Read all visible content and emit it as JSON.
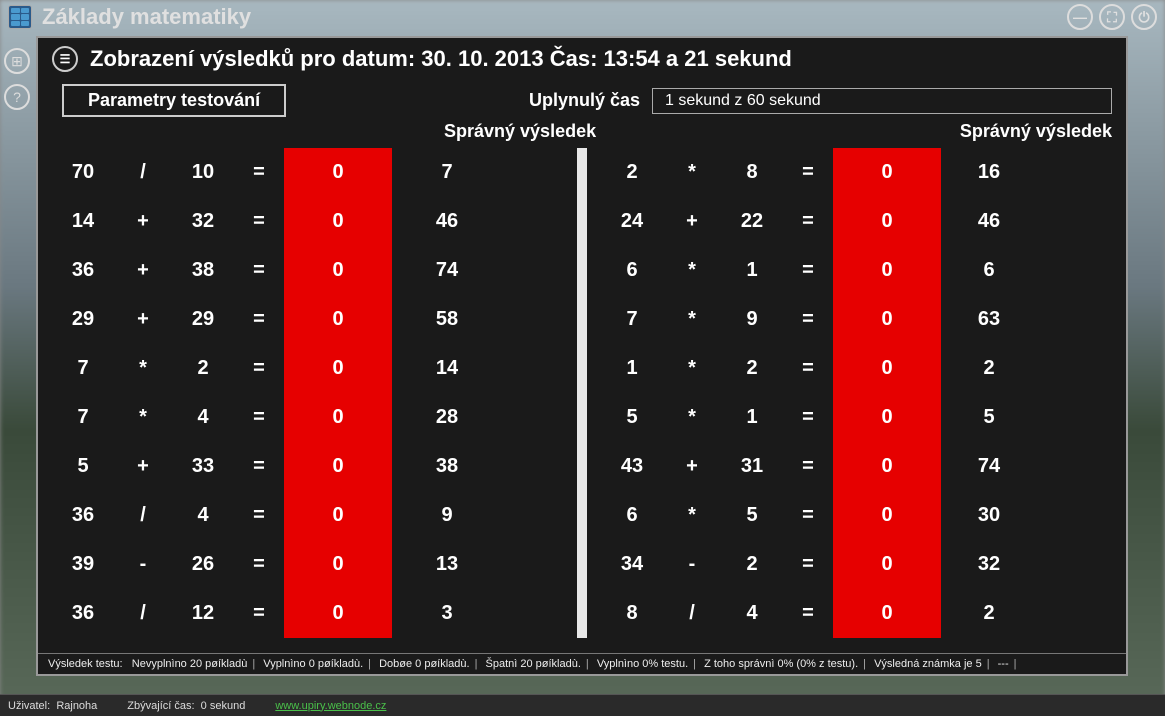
{
  "app": {
    "title": "Základy matematiky"
  },
  "panel": {
    "title": "Zobrazení výsledků pro datum: 30. 10. 2013 Čas: 13:54 a 21 sekund",
    "paramBox": "Parametry testování",
    "elapsedLabel": "Uplynulý čas",
    "elapsedValue": "1 sekund z 60 sekund",
    "correctHeader": "Správný výsledek"
  },
  "left": [
    {
      "a": "70",
      "op": "/",
      "b": "10",
      "eq": "=",
      "ans": "0",
      "correct": "7"
    },
    {
      "a": "14",
      "op": "+",
      "b": "32",
      "eq": "=",
      "ans": "0",
      "correct": "46"
    },
    {
      "a": "36",
      "op": "+",
      "b": "38",
      "eq": "=",
      "ans": "0",
      "correct": "74"
    },
    {
      "a": "29",
      "op": "+",
      "b": "29",
      "eq": "=",
      "ans": "0",
      "correct": "58"
    },
    {
      "a": "7",
      "op": "*",
      "b": "2",
      "eq": "=",
      "ans": "0",
      "correct": "14"
    },
    {
      "a": "7",
      "op": "*",
      "b": "4",
      "eq": "=",
      "ans": "0",
      "correct": "28"
    },
    {
      "a": "5",
      "op": "+",
      "b": "33",
      "eq": "=",
      "ans": "0",
      "correct": "38"
    },
    {
      "a": "36",
      "op": "/",
      "b": "4",
      "eq": "=",
      "ans": "0",
      "correct": "9"
    },
    {
      "a": "39",
      "op": "-",
      "b": "26",
      "eq": "=",
      "ans": "0",
      "correct": "13"
    },
    {
      "a": "36",
      "op": "/",
      "b": "12",
      "eq": "=",
      "ans": "0",
      "correct": "3"
    }
  ],
  "right": [
    {
      "a": "2",
      "op": "*",
      "b": "8",
      "eq": "=",
      "ans": "0",
      "correct": "16"
    },
    {
      "a": "24",
      "op": "+",
      "b": "22",
      "eq": "=",
      "ans": "0",
      "correct": "46"
    },
    {
      "a": "6",
      "op": "*",
      "b": "1",
      "eq": "=",
      "ans": "0",
      "correct": "6"
    },
    {
      "a": "7",
      "op": "*",
      "b": "9",
      "eq": "=",
      "ans": "0",
      "correct": "63"
    },
    {
      "a": "1",
      "op": "*",
      "b": "2",
      "eq": "=",
      "ans": "0",
      "correct": "2"
    },
    {
      "a": "5",
      "op": "*",
      "b": "1",
      "eq": "=",
      "ans": "0",
      "correct": "5"
    },
    {
      "a": "43",
      "op": "+",
      "b": "31",
      "eq": "=",
      "ans": "0",
      "correct": "74"
    },
    {
      "a": "6",
      "op": "*",
      "b": "5",
      "eq": "=",
      "ans": "0",
      "correct": "30"
    },
    {
      "a": "34",
      "op": "-",
      "b": "2",
      "eq": "=",
      "ans": "0",
      "correct": "32"
    },
    {
      "a": "8",
      "op": "/",
      "b": "4",
      "eq": "=",
      "ans": "0",
      "correct": "2"
    }
  ],
  "footer": {
    "label": "Výsledek testu:",
    "s1": "Nevyplnìno 20 pøíkladù",
    "s2": "Vyplnìno 0 pøíkladù.",
    "s3": "Dobøe 0 pøíkladù.",
    "s4": "Špatnì 20 pøíkladù.",
    "s5": "Vyplnìno 0% testu.",
    "s6": "Z toho správnì 0% (0% z testu).",
    "s7": "Výsledná známka je 5",
    "s8": "---"
  },
  "status": {
    "userLabel": "Uživatel:",
    "user": "Rajnoha",
    "timeLabel": "Zbývající čas:",
    "time": "0 sekund",
    "link": "www.upiry.webnode.cz"
  }
}
